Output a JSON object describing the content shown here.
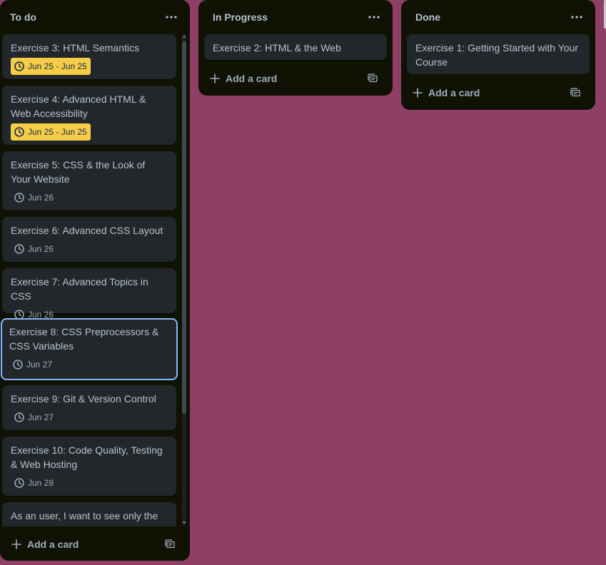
{
  "lists": [
    {
      "title": "To do",
      "add_card_label": "Add a card",
      "cards": [
        {
          "title": "Exercise 3: HTML Semantics",
          "date": "Jun 25 - Jun 25",
          "due_soon": true
        },
        {
          "title": "Exercise 4: Advanced HTML & Web Accessibility",
          "date": "Jun 25 - Jun 25",
          "due_soon": true
        },
        {
          "title": "Exercise 5: CSS & the Look of Your Website",
          "date": "Jun 26",
          "due_soon": false
        },
        {
          "title": "Exercise 6: Advanced CSS Layout",
          "date": "Jun 26",
          "due_soon": false
        },
        {
          "title": "Exercise 7: Advanced Topics in CSS",
          "date": "Jun 26",
          "due_soon": false
        },
        {
          "title": "Exercise 8: CSS Preprocessors & CSS Variables",
          "date": "Jun 27",
          "due_soon": false
        },
        {
          "title": "Exercise 9: Git & Version Control",
          "date": "Jun 27",
          "due_soon": false
        },
        {
          "title": "Exercise 10: Code Quality, Testing & Web Hosting",
          "date": "Jun 28",
          "due_soon": false
        },
        {
          "title": "As an user, I want to see only the",
          "date": null,
          "due_soon": false
        }
      ]
    },
    {
      "title": "In Progress",
      "add_card_label": "Add a card",
      "cards": [
        {
          "title": "Exercise 2: HTML & the Web",
          "date": null,
          "due_soon": false
        }
      ]
    },
    {
      "title": "Done",
      "add_card_label": "Add a card",
      "cards": [
        {
          "title": "Exercise 1: Getting Started with Your Course",
          "date": null,
          "due_soon": false
        }
      ]
    }
  ],
  "icons": {
    "list_menu": "ellipsis-icon",
    "date": "clock-icon",
    "add": "plus-icon",
    "template": "card-template-icon"
  },
  "colors": {
    "board_background": "#8f3f65",
    "list_background": "#101204",
    "card_background": "#22272b",
    "due_soon_badge": "#f5cd47",
    "selected_card_border": "#85b8ff"
  }
}
